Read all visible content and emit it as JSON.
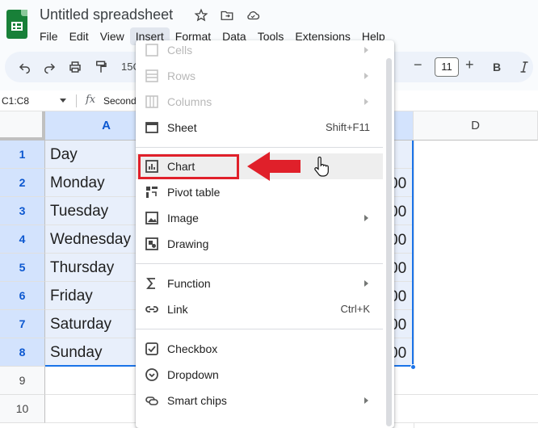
{
  "app": {
    "title": "Untitled spreadsheet",
    "brand_color": "#188038"
  },
  "menubar": {
    "items": [
      "File",
      "Edit",
      "View",
      "Insert",
      "Format",
      "Data",
      "Tools",
      "Extensions",
      "Help"
    ],
    "active": "Insert"
  },
  "toolbar": {
    "zoom_partial": "15C",
    "font_size": "11",
    "bold": "B"
  },
  "formula_bar": {
    "name_box": "C1:C8",
    "fx": "fx",
    "content_partial": "Second"
  },
  "grid": {
    "columns": [
      {
        "label": "A",
        "selected": true
      },
      {
        "label": "D",
        "selected": false
      }
    ],
    "rows": [
      {
        "num": "1",
        "a": "Day",
        "selected": true,
        "c_partial": ""
      },
      {
        "num": "2",
        "a": "Monday",
        "selected": true,
        "c_partial": "00"
      },
      {
        "num": "3",
        "a": "Tuesday",
        "selected": true,
        "c_partial": "00"
      },
      {
        "num": "4",
        "a": "Wednesday",
        "selected": true,
        "c_partial": "00"
      },
      {
        "num": "5",
        "a": "Thursday",
        "selected": true,
        "c_partial": "00"
      },
      {
        "num": "6",
        "a": "Friday",
        "selected": true,
        "c_partial": "00"
      },
      {
        "num": "7",
        "a": "Saturday",
        "selected": true,
        "c_partial": "00"
      },
      {
        "num": "8",
        "a": "Sunday",
        "selected": true,
        "c_partial": "00"
      },
      {
        "num": "9",
        "a": "",
        "selected": false,
        "c_partial": ""
      },
      {
        "num": "10",
        "a": "",
        "selected": false,
        "c_partial": ""
      }
    ],
    "selection_color": "#1a73e8"
  },
  "insert_menu": {
    "items": [
      {
        "label": "Cells",
        "icon": "cells-icon",
        "disabled": true,
        "submenu": true,
        "shortcut": ""
      },
      {
        "label": "Rows",
        "icon": "rows-icon",
        "disabled": true,
        "submenu": true,
        "shortcut": ""
      },
      {
        "label": "Columns",
        "icon": "columns-icon",
        "disabled": true,
        "submenu": true,
        "shortcut": ""
      },
      {
        "label": "Sheet",
        "icon": "sheet-icon",
        "disabled": false,
        "submenu": false,
        "shortcut": "Shift+F11"
      },
      {
        "label": "Chart",
        "icon": "chart-icon",
        "disabled": false,
        "submenu": false,
        "shortcut": "",
        "highlighted": true
      },
      {
        "label": "Pivot table",
        "icon": "pivot-table-icon",
        "disabled": false,
        "submenu": false,
        "shortcut": ""
      },
      {
        "label": "Image",
        "icon": "image-icon",
        "disabled": false,
        "submenu": true,
        "shortcut": ""
      },
      {
        "label": "Drawing",
        "icon": "drawing-icon",
        "disabled": false,
        "submenu": false,
        "shortcut": ""
      },
      {
        "label": "Function",
        "icon": "sigma-icon",
        "disabled": false,
        "submenu": true,
        "shortcut": ""
      },
      {
        "label": "Link",
        "icon": "link-icon",
        "disabled": false,
        "submenu": false,
        "shortcut": "Ctrl+K"
      },
      {
        "label": "Checkbox",
        "icon": "checkbox-icon",
        "disabled": false,
        "submenu": false,
        "shortcut": ""
      },
      {
        "label": "Dropdown",
        "icon": "dropdown-icon",
        "disabled": false,
        "submenu": false,
        "shortcut": ""
      },
      {
        "label": "Smart chips",
        "icon": "smart-chips-icon",
        "disabled": false,
        "submenu": true,
        "shortcut": ""
      }
    ]
  },
  "annotation": {
    "color": "#e0202a"
  }
}
